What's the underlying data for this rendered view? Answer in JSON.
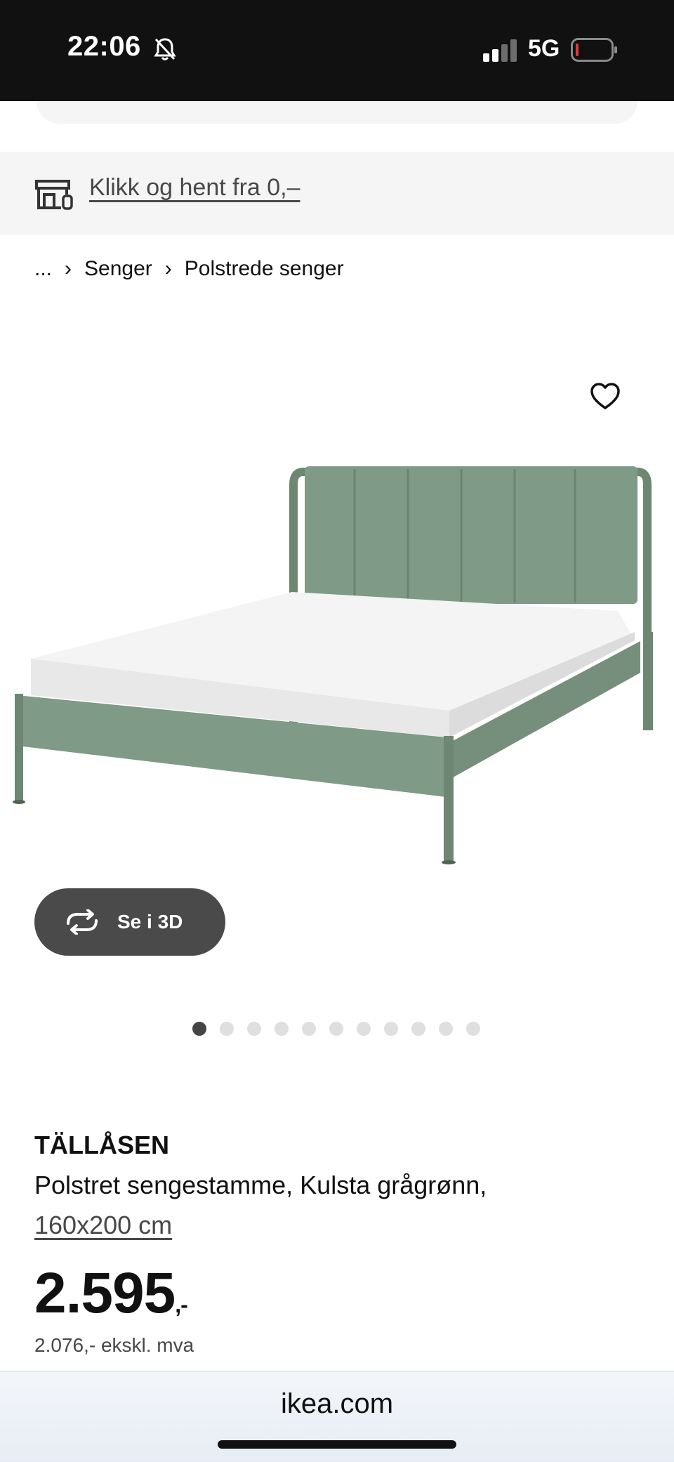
{
  "status_bar": {
    "time": "22:06",
    "network": "5G"
  },
  "pickup_banner": {
    "link_text": "Klikk og hent fra 0,–"
  },
  "breadcrumb": {
    "items": [
      "...",
      "Senger",
      "Polstrede senger"
    ]
  },
  "gallery": {
    "view_3d_label": "Se i 3D",
    "dot_count": 11,
    "active_index": 0
  },
  "product": {
    "name": "TÄLLÅSEN",
    "description": "Polstret sengestamme, Kulsta grågrønn,",
    "size": "160x200 cm",
    "price_main": "2.595",
    "price_suffix": ",-",
    "price_ex_vat": "2.076,- ekskl. mva"
  },
  "browser": {
    "url": "ikea.com"
  },
  "colors": {
    "fabric": "#7f9a86",
    "button_dark": "#4a4a4a",
    "banner_bg": "#f5f5f5"
  }
}
